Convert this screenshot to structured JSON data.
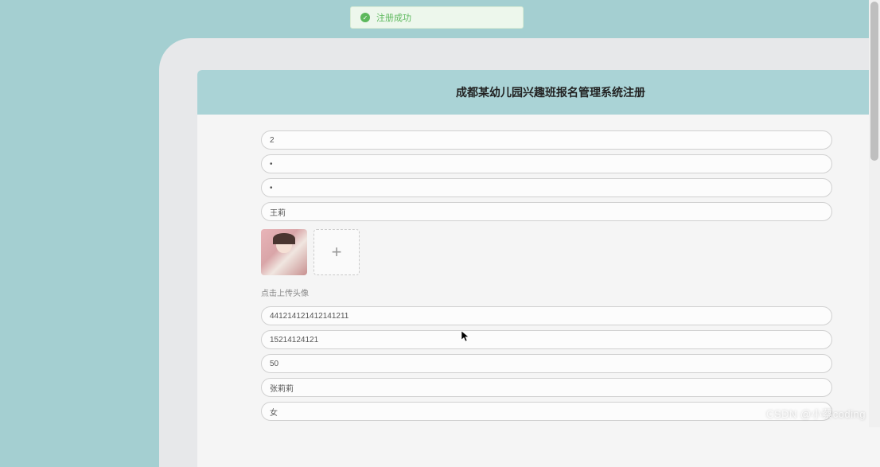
{
  "toast": {
    "message": "注册成功"
  },
  "header": {
    "title": "成都某幼儿园兴趣班报名管理系统注册"
  },
  "form": {
    "field1": "2",
    "field2": "•",
    "field3": "•",
    "field4": "王莉",
    "uploadLabel": "点击上传头像",
    "field5": "441214121412141211",
    "field6": "15214124121",
    "field7": "50",
    "field8": "张莉莉",
    "field9": "女"
  },
  "watermark": "CSDN @小蔡coding"
}
